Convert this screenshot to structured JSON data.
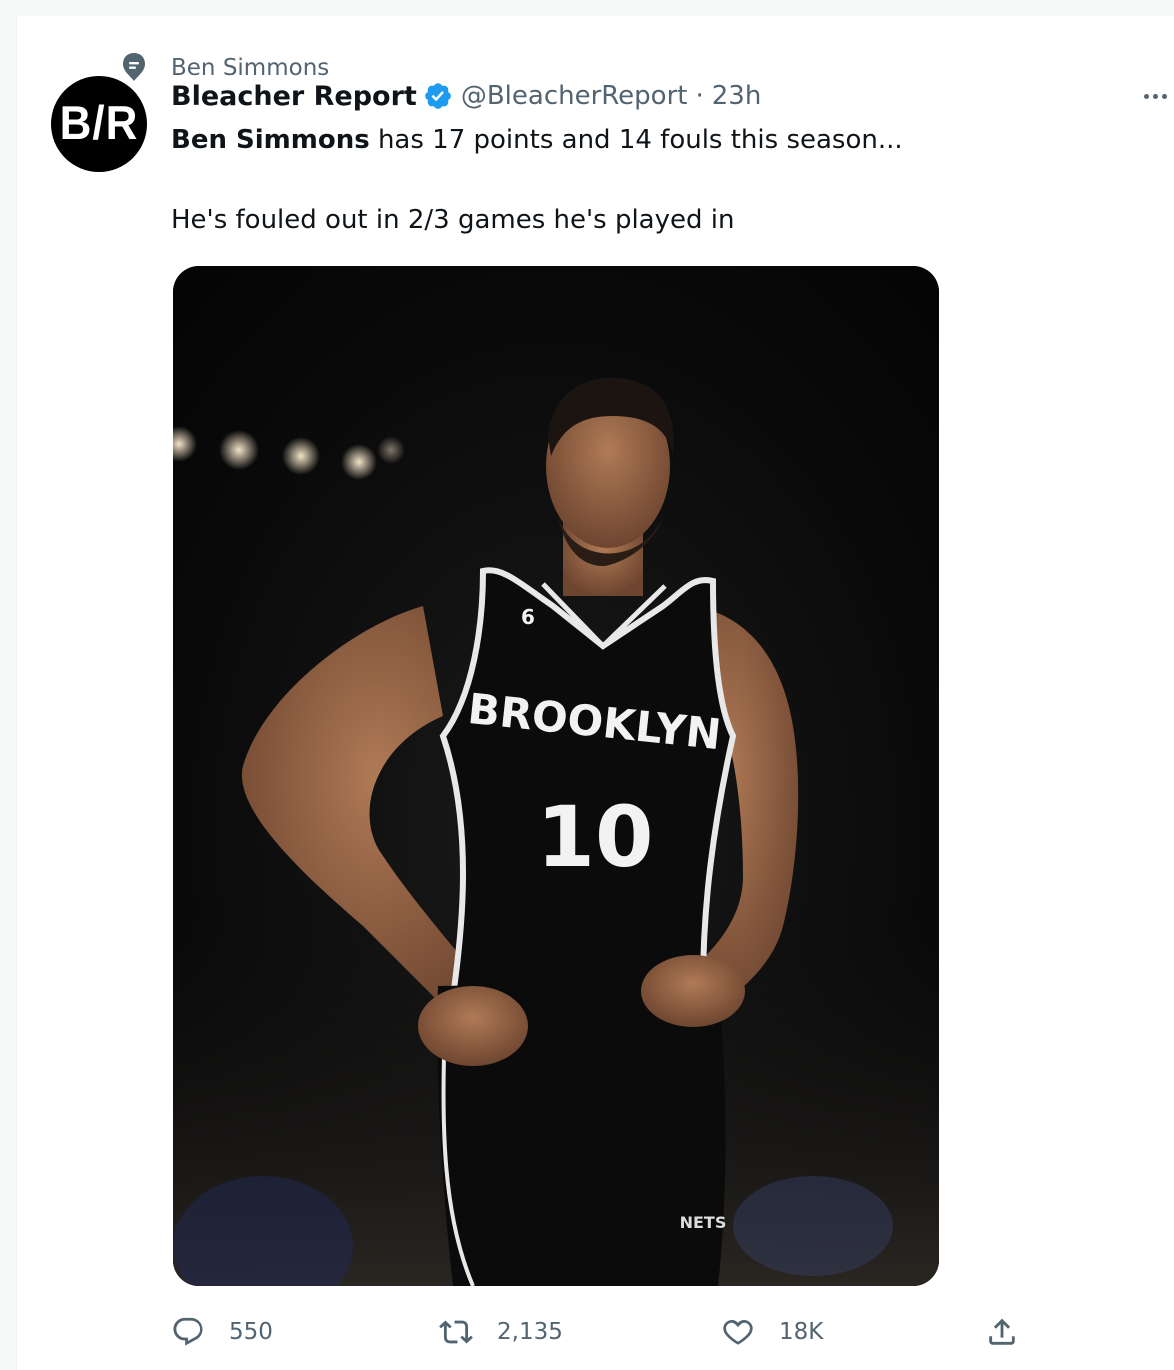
{
  "context": {
    "text": "Ben Simmons",
    "icon": "pinned-topic-icon"
  },
  "author": {
    "name": "Bleacher Report",
    "avatar_text": "B/R",
    "verified": true,
    "handle": "@BleacherReport",
    "separator": "·",
    "time": "23h"
  },
  "tweet": {
    "mention": "Ben Simmons",
    "line1_rest": " has 17 points and 14 fouls this season...",
    "line2": "He's fouled out in 2/3 games he's played in"
  },
  "media": {
    "jersey_team": "BROOKLYN",
    "jersey_number": "10",
    "jersey_patch": "6",
    "shorts_logo": "NETS"
  },
  "actions": {
    "reply_count": "550",
    "retweet_count": "2,135",
    "like_count": "18K"
  },
  "colors": {
    "verified_blue": "#1d9bf0",
    "secondary_text": "#536471",
    "primary_text": "#0f1419"
  }
}
